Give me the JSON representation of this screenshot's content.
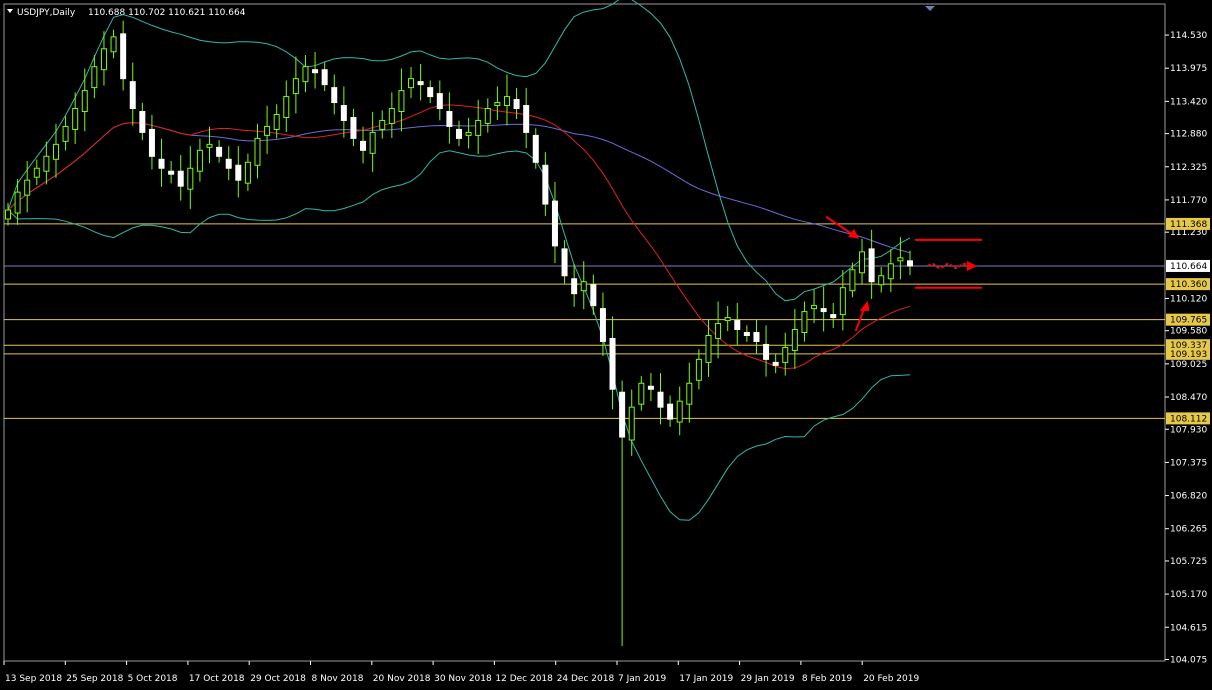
{
  "header": {
    "symbol_timeframe": "USDJPY,Daily",
    "ohlc": "110.688 110.702 110.621 110.664"
  },
  "chart_data": {
    "type": "candlestick",
    "x_ticks": [
      "13 Sep 2018",
      "25 Sep 2018",
      "5 Oct 2018",
      "17 Oct 2018",
      "29 Oct 2018",
      "8 Nov 2018",
      "20 Nov 2018",
      "30 Nov 2018",
      "12 Dec 2018",
      "24 Dec 2018",
      "7 Jan 2019",
      "17 Jan 2019",
      "29 Jan 2019",
      "8 Feb 2019",
      "20 Feb 2019"
    ],
    "y_ticks": [
      "114.530",
      "113.975",
      "113.420",
      "112.880",
      "112.325",
      "111.770",
      "111.230",
      "110.120",
      "109.580",
      "109.025",
      "108.470",
      "107.930",
      "107.375",
      "106.820",
      "106.265",
      "105.725",
      "105.170",
      "104.615",
      "104.075"
    ],
    "ylim": [
      104.05,
      115.05
    ],
    "current_price": "110.664",
    "horizontal_levels": [
      {
        "label": "111.368",
        "value": 111.368,
        "color": "#e6c84a"
      },
      {
        "label": "110.360",
        "value": 110.36,
        "color": "#e6c84a"
      },
      {
        "label": "109.765",
        "value": 109.765,
        "color": "#e6c84a"
      },
      {
        "label": "109.337",
        "value": 109.337,
        "color": "#e6c84a"
      },
      {
        "label": "109.193",
        "value": 109.193,
        "color": "#e6c84a"
      },
      {
        "label": "108.112",
        "value": 108.112,
        "color": "#e6c84a"
      }
    ],
    "close_path": [
      111.6,
      111.9,
      112.1,
      112.3,
      112.5,
      112.7,
      113.0,
      113.3,
      113.6,
      114.0,
      114.3,
      114.5,
      113.8,
      113.3,
      112.9,
      112.5,
      112.3,
      112.2,
      112.0,
      112.3,
      112.6,
      112.7,
      112.5,
      112.3,
      112.1,
      112.4,
      112.8,
      113.0,
      113.2,
      113.5,
      113.8,
      114.0,
      113.9,
      113.7,
      113.4,
      113.1,
      112.8,
      112.6,
      112.9,
      113.1,
      113.3,
      113.6,
      113.8,
      113.7,
      113.5,
      113.3,
      113.0,
      112.8,
      112.9,
      113.1,
      113.3,
      113.4,
      113.5,
      113.3,
      112.9,
      112.4,
      111.7,
      111.0,
      110.5,
      110.2,
      110.4,
      110.0,
      109.4,
      108.6,
      107.8,
      108.3,
      108.7,
      108.6,
      108.3,
      108.1,
      108.4,
      108.7,
      109.1,
      109.5,
      109.7,
      109.8,
      109.6,
      109.5,
      109.4,
      109.1,
      109.0,
      109.3,
      109.6,
      109.9,
      110.0,
      109.9,
      109.8,
      110.3,
      110.6,
      110.9,
      110.4,
      110.5,
      110.7,
      110.8,
      110.664
    ],
    "indicators": [
      {
        "kind": "sma-red",
        "color": "#e02020"
      },
      {
        "kind": "sma-blue",
        "color": "#6b6bdc"
      },
      {
        "kind": "bollinger",
        "color": "#2fb8a8"
      }
    ],
    "annotations": [
      {
        "kind": "arrow-down-to-high",
        "color": "#ff0000"
      },
      {
        "kind": "arrow-up-to-low",
        "color": "#ff0000"
      },
      {
        "kind": "range-lines",
        "color": "#ff0000"
      },
      {
        "kind": "dotted-forward-arrow",
        "color": "#ff0000"
      }
    ],
    "colors": {
      "bull": "#ffffff",
      "bear": "#ffffff",
      "wick": "#7cfc00",
      "grid_bg": "#000000",
      "axis": "#ffffff"
    }
  }
}
